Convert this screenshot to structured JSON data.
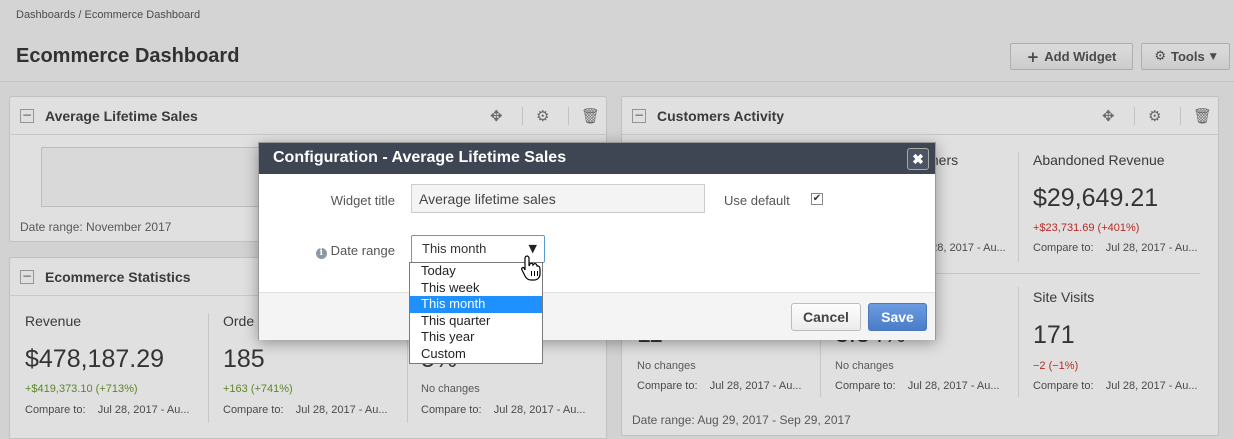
{
  "breadcrumb": {
    "root": "Dashboards",
    "separator": "/",
    "current": "Ecommerce Dashboard"
  },
  "page_title": "Ecommerce Dashboard",
  "toolbar": {
    "add_widget_label": "Add Widget",
    "tools_label": "Tools"
  },
  "panels": {
    "avg_lifetime": {
      "title": "Average Lifetime Sales",
      "date_range": "Date range: November 2017"
    },
    "ecommerce_stats": {
      "title": "Ecommerce Statistics",
      "stats": [
        {
          "label": "Revenue",
          "value": "$478,187.29",
          "change": "+$419,373.10 (+713%)",
          "compare_label": "Compare to:",
          "compare_value": "Jul 28, 2017 - Au..."
        },
        {
          "label": "Orde",
          "value": "185",
          "change": "+163 (+741%)",
          "compare_label": "Compare to:",
          "compare_value": "Jul 28, 2017 - Au..."
        },
        {
          "label": "",
          "value": "5%",
          "change": "No changes",
          "compare_label": "Compare to:",
          "compare_value": "Jul 28, 2017 - Au..."
        }
      ]
    },
    "customers_activity": {
      "title": "Customers Activity",
      "row1": [
        {
          "label": "mers",
          "compare_value": "Jul 28, 2017 - Au..."
        },
        {
          "label": "Abandoned Revenue",
          "value": "$29,649.21",
          "change": "+$23,731.69 (+401%)",
          "compare_label": "Compare to:",
          "compare_value": "Jul 28, 2017 - Au..."
        }
      ],
      "row2": [
        {
          "value": "11",
          "change": "No changes",
          "compare_label": "Compare to:",
          "compare_value": "Jul 28, 2017 - Au..."
        },
        {
          "value": "3.34%",
          "change": "No changes",
          "compare_label": "Compare to:",
          "compare_value": "Jul 28, 2017 - Au..."
        },
        {
          "label": "Site Visits",
          "value": "171",
          "change": "−2 (−1%)",
          "compare_label": "Compare to:",
          "compare_value": "Jul 28, 2017 - Au..."
        }
      ],
      "date_range": "Date range: Aug 29, 2017 - Sep 29, 2017"
    }
  },
  "modal": {
    "title": "Configuration - Average Lifetime Sales",
    "close_label": "✖",
    "widget_title_label": "Widget title",
    "widget_title_value": "Average lifetime sales",
    "use_default_label": "Use default",
    "use_default_checked": true,
    "date_range_label": "Date range",
    "date_range_selected": "This month",
    "date_range_options": [
      "Today",
      "This week",
      "This month",
      "This quarter",
      "This year",
      "Custom"
    ],
    "cancel_label": "Cancel",
    "save_label": "Save"
  },
  "colors": {
    "accent": "#4a7cc9",
    "modal_header": "#3d4652",
    "positive": "#6a9a2f",
    "negative": "#d0312d",
    "dropdown_highlight": "#1e90ff"
  }
}
